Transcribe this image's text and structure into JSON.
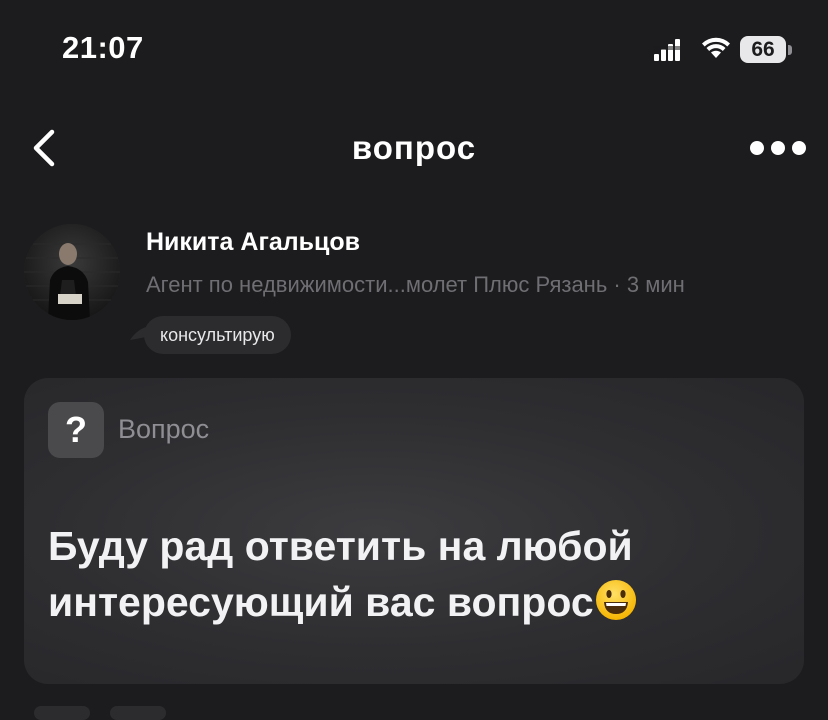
{
  "status_bar": {
    "time": "21:07",
    "battery": "66"
  },
  "nav": {
    "title": "вопрос",
    "back_icon": "chevron-left-icon",
    "more_icon": "more-horizontal-icon"
  },
  "author": {
    "name": "Никита Агальцов",
    "meta": "Агент по недвижимости...молет Плюс Рязань · 3 мин",
    "tag": "консультирую"
  },
  "card": {
    "type_label": "Вопрос",
    "type_icon_glyph": "?",
    "text": "Буду рад ответить на любой интересующий вас вопрос",
    "emoji": "smiling-face-emoji"
  },
  "colors": {
    "background": "#1c1c1e",
    "card": "#2e2e31",
    "secondary_text": "#6e6e73",
    "tag_background": "#2c2c2e"
  }
}
